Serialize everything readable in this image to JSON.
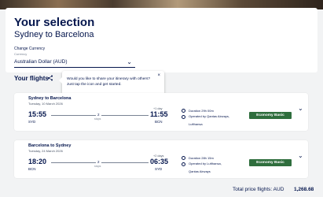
{
  "header": {
    "title": "Your selection",
    "subtitle": "Sydney to Barcelona",
    "currency_label": "Change Currency",
    "currency_sublabel": "Currency",
    "currency_value": "Australian Dollar (AUD)"
  },
  "flights_heading": "Your flights",
  "tooltip": {
    "text": "Would you like to share your itinerary with others? Just tap the icon and get started.",
    "close": "×"
  },
  "flights": [
    {
      "route": "Sydney to Barcelona",
      "date": "Tuesday, 10 March 2026",
      "dep_time": "15:55",
      "dep_code": "SYD",
      "stops": "2",
      "stops_label": "stops",
      "day_offset": "+1 day",
      "arr_time": "11:55",
      "arr_code": "BCN",
      "duration": "Duration 29h 00m",
      "operated_by": "Operated by Qantas Airways,",
      "airline": "Lufthansa",
      "fare": "Economy Basic"
    },
    {
      "route": "Barcelona to Sydney",
      "date": "Tuesday, 24 March 2026",
      "dep_time": "18:20",
      "dep_code": "BCN",
      "stops": "2",
      "stops_label": "stops",
      "day_offset": "+2 days",
      "arr_time": "06:35",
      "arr_code": "SYD",
      "duration": "Duration 28h 15m",
      "operated_by": "Operated by Lufthansa,",
      "airline": "Qantas Airways",
      "fare": "Economy Basic"
    }
  ],
  "total": {
    "label": "Total price flights: AUD",
    "amount": "1,268.68"
  },
  "colors": {
    "brand": "#05164d",
    "fare_button": "#2f6e3d",
    "background": "#f2f3f4"
  }
}
